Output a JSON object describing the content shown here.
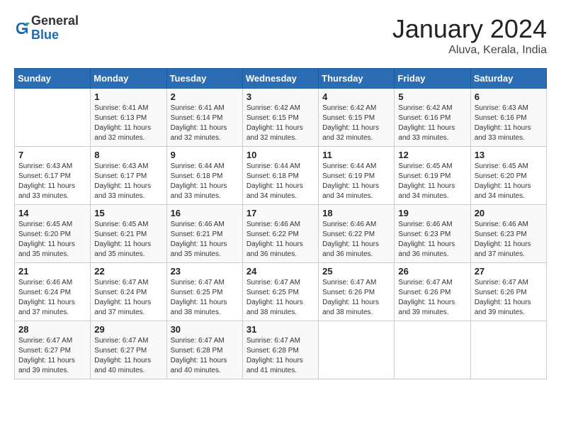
{
  "logo": {
    "general": "General",
    "blue": "Blue"
  },
  "title": "January 2024",
  "location": "Aluva, Kerala, India",
  "weekdays": [
    "Sunday",
    "Monday",
    "Tuesday",
    "Wednesday",
    "Thursday",
    "Friday",
    "Saturday"
  ],
  "weeks": [
    [
      {
        "day": null
      },
      {
        "day": "1",
        "sunrise": "6:41 AM",
        "sunset": "6:13 PM",
        "daylight": "11 hours and 32 minutes."
      },
      {
        "day": "2",
        "sunrise": "6:41 AM",
        "sunset": "6:14 PM",
        "daylight": "11 hours and 32 minutes."
      },
      {
        "day": "3",
        "sunrise": "6:42 AM",
        "sunset": "6:15 PM",
        "daylight": "11 hours and 32 minutes."
      },
      {
        "day": "4",
        "sunrise": "6:42 AM",
        "sunset": "6:15 PM",
        "daylight": "11 hours and 32 minutes."
      },
      {
        "day": "5",
        "sunrise": "6:42 AM",
        "sunset": "6:16 PM",
        "daylight": "11 hours and 33 minutes."
      },
      {
        "day": "6",
        "sunrise": "6:43 AM",
        "sunset": "6:16 PM",
        "daylight": "11 hours and 33 minutes."
      }
    ],
    [
      {
        "day": "7",
        "sunrise": "6:43 AM",
        "sunset": "6:17 PM",
        "daylight": "11 hours and 33 minutes."
      },
      {
        "day": "8",
        "sunrise": "6:43 AM",
        "sunset": "6:17 PM",
        "daylight": "11 hours and 33 minutes."
      },
      {
        "day": "9",
        "sunrise": "6:44 AM",
        "sunset": "6:18 PM",
        "daylight": "11 hours and 33 minutes."
      },
      {
        "day": "10",
        "sunrise": "6:44 AM",
        "sunset": "6:18 PM",
        "daylight": "11 hours and 34 minutes."
      },
      {
        "day": "11",
        "sunrise": "6:44 AM",
        "sunset": "6:19 PM",
        "daylight": "11 hours and 34 minutes."
      },
      {
        "day": "12",
        "sunrise": "6:45 AM",
        "sunset": "6:19 PM",
        "daylight": "11 hours and 34 minutes."
      },
      {
        "day": "13",
        "sunrise": "6:45 AM",
        "sunset": "6:20 PM",
        "daylight": "11 hours and 34 minutes."
      }
    ],
    [
      {
        "day": "14",
        "sunrise": "6:45 AM",
        "sunset": "6:20 PM",
        "daylight": "11 hours and 35 minutes."
      },
      {
        "day": "15",
        "sunrise": "6:45 AM",
        "sunset": "6:21 PM",
        "daylight": "11 hours and 35 minutes."
      },
      {
        "day": "16",
        "sunrise": "6:46 AM",
        "sunset": "6:21 PM",
        "daylight": "11 hours and 35 minutes."
      },
      {
        "day": "17",
        "sunrise": "6:46 AM",
        "sunset": "6:22 PM",
        "daylight": "11 hours and 36 minutes."
      },
      {
        "day": "18",
        "sunrise": "6:46 AM",
        "sunset": "6:22 PM",
        "daylight": "11 hours and 36 minutes."
      },
      {
        "day": "19",
        "sunrise": "6:46 AM",
        "sunset": "6:23 PM",
        "daylight": "11 hours and 36 minutes."
      },
      {
        "day": "20",
        "sunrise": "6:46 AM",
        "sunset": "6:23 PM",
        "daylight": "11 hours and 37 minutes."
      }
    ],
    [
      {
        "day": "21",
        "sunrise": "6:46 AM",
        "sunset": "6:24 PM",
        "daylight": "11 hours and 37 minutes."
      },
      {
        "day": "22",
        "sunrise": "6:47 AM",
        "sunset": "6:24 PM",
        "daylight": "11 hours and 37 minutes."
      },
      {
        "day": "23",
        "sunrise": "6:47 AM",
        "sunset": "6:25 PM",
        "daylight": "11 hours and 38 minutes."
      },
      {
        "day": "24",
        "sunrise": "6:47 AM",
        "sunset": "6:25 PM",
        "daylight": "11 hours and 38 minutes."
      },
      {
        "day": "25",
        "sunrise": "6:47 AM",
        "sunset": "6:26 PM",
        "daylight": "11 hours and 38 minutes."
      },
      {
        "day": "26",
        "sunrise": "6:47 AM",
        "sunset": "6:26 PM",
        "daylight": "11 hours and 39 minutes."
      },
      {
        "day": "27",
        "sunrise": "6:47 AM",
        "sunset": "6:26 PM",
        "daylight": "11 hours and 39 minutes."
      }
    ],
    [
      {
        "day": "28",
        "sunrise": "6:47 AM",
        "sunset": "6:27 PM",
        "daylight": "11 hours and 39 minutes."
      },
      {
        "day": "29",
        "sunrise": "6:47 AM",
        "sunset": "6:27 PM",
        "daylight": "11 hours and 40 minutes."
      },
      {
        "day": "30",
        "sunrise": "6:47 AM",
        "sunset": "6:28 PM",
        "daylight": "11 hours and 40 minutes."
      },
      {
        "day": "31",
        "sunrise": "6:47 AM",
        "sunset": "6:28 PM",
        "daylight": "11 hours and 41 minutes."
      },
      {
        "day": null
      },
      {
        "day": null
      },
      {
        "day": null
      }
    ]
  ]
}
